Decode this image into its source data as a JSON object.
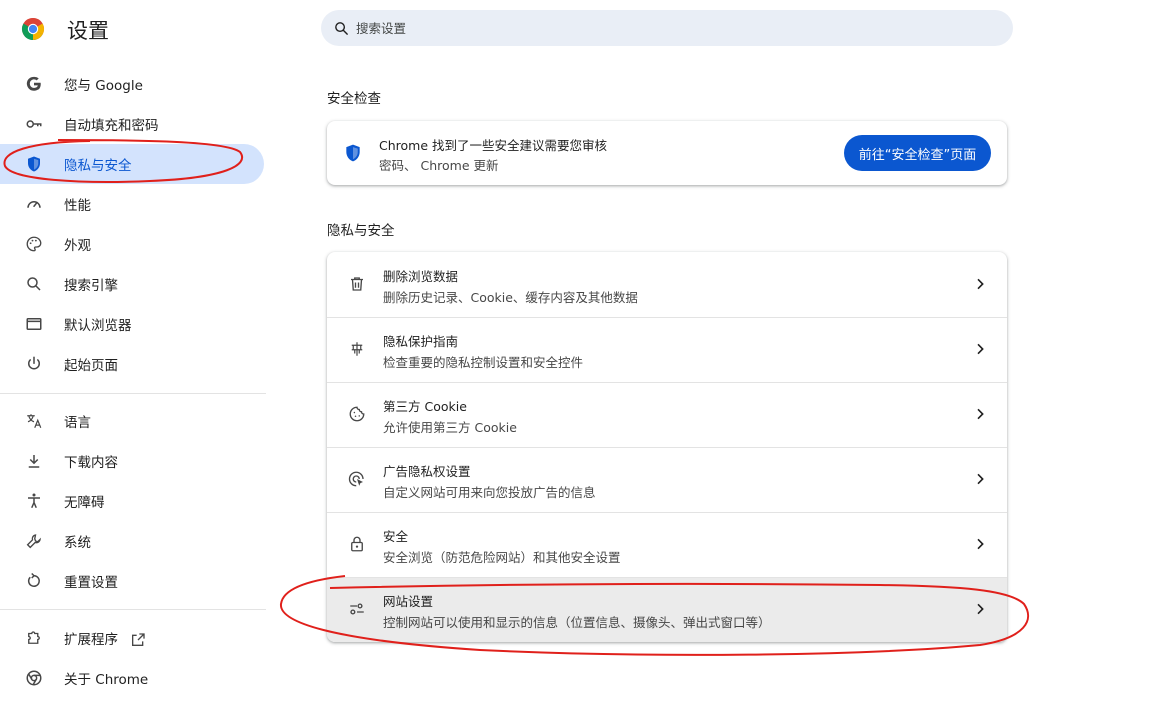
{
  "header": {
    "title": "设置",
    "search_placeholder": "搜索设置"
  },
  "sidebar": {
    "items": [
      {
        "label": "您与 Google",
        "icon": "google-g-icon"
      },
      {
        "label": "自动填充和密码",
        "icon": "key-icon"
      },
      {
        "label": "隐私与安全",
        "icon": "shield-icon",
        "active": true
      },
      {
        "label": "性能",
        "icon": "speedometer-icon"
      },
      {
        "label": "外观",
        "icon": "palette-icon"
      },
      {
        "label": "搜索引擎",
        "icon": "search-icon"
      },
      {
        "label": "默认浏览器",
        "icon": "browser-window-icon"
      },
      {
        "label": "起始页面",
        "icon": "power-icon"
      },
      {
        "label": "语言",
        "icon": "translate-icon"
      },
      {
        "label": "下载内容",
        "icon": "download-icon"
      },
      {
        "label": "无障碍",
        "icon": "accessibility-icon"
      },
      {
        "label": "系统",
        "icon": "wrench-icon"
      },
      {
        "label": "重置设置",
        "icon": "reset-icon"
      },
      {
        "label": "扩展程序",
        "icon": "puzzle-icon",
        "external": true
      },
      {
        "label": "关于 Chrome",
        "icon": "chrome-icon"
      }
    ]
  },
  "safety_check": {
    "section_title": "安全检查",
    "primary": "Chrome 找到了一些安全建议需要您审核",
    "secondary": "密码、 Chrome 更新",
    "button_label": "前往“安全检查”页面"
  },
  "privacy": {
    "section_title": "隐私与安全",
    "rows": [
      {
        "title": "删除浏览数据",
        "desc": "删除历史记录、Cookie、缓存内容及其他数据",
        "icon": "trash-icon"
      },
      {
        "title": "隐私保护指南",
        "desc": "检查重要的隐私控制设置和安全控件",
        "icon": "privacy-guide-icon"
      },
      {
        "title": "第三方 Cookie",
        "desc": "允许使用第三方 Cookie",
        "icon": "cookie-icon"
      },
      {
        "title": "广告隐私权设置",
        "desc": "自定义网站可用来向您投放广告的信息",
        "icon": "ad-privacy-icon"
      },
      {
        "title": "安全",
        "desc": "安全浏览（防范危险网站）和其他安全设置",
        "icon": "lock-icon"
      },
      {
        "title": "网站设置",
        "desc": "控制网站可以使用和显示的信息（位置信息、摄像头、弹出式窗口等）",
        "icon": "sliders-icon",
        "highlighted": true
      }
    ]
  },
  "colors": {
    "accent": "#0b57d0",
    "active_bg": "#d3e3fd",
    "search_bg": "#e9eef6",
    "annotation": "#e0201b"
  }
}
